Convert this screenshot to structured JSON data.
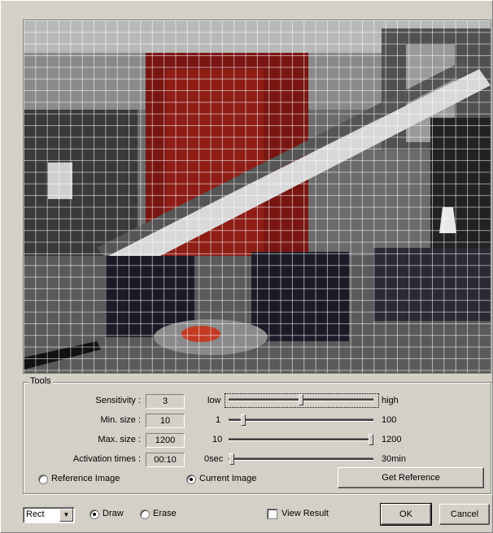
{
  "tools": {
    "title": "Tools",
    "sensitivity": {
      "label": "Sensitivity :",
      "value": "3",
      "min_label": "low",
      "max_label": "high",
      "level": 0.5
    },
    "min_size": {
      "label": "Min. size :",
      "value": "10",
      "min_label": "1",
      "max_label": "100",
      "level": 0.09
    },
    "max_size": {
      "label": "Max. size :",
      "value": "1200",
      "min_label": "10",
      "max_label": "1200",
      "level": 1.0
    },
    "activation_times": {
      "label": "Activation times :",
      "value": "00:10",
      "min_label": "0sec",
      "max_label": "30min",
      "level": 0.005
    },
    "reference_image_label": "Reference Image",
    "current_image_label": "Current Image",
    "get_reference_label": "Get Reference"
  },
  "bottom": {
    "shape_value": "Rect",
    "draw_label": "Draw",
    "erase_label": "Erase",
    "view_result_label": "View Result",
    "ok_label": "OK",
    "cancel_label": "Cancel"
  },
  "state": {
    "image_source": "current",
    "mode": "draw",
    "view_result": false
  },
  "icons": {
    "dropdown": "chevron-down-icon"
  }
}
